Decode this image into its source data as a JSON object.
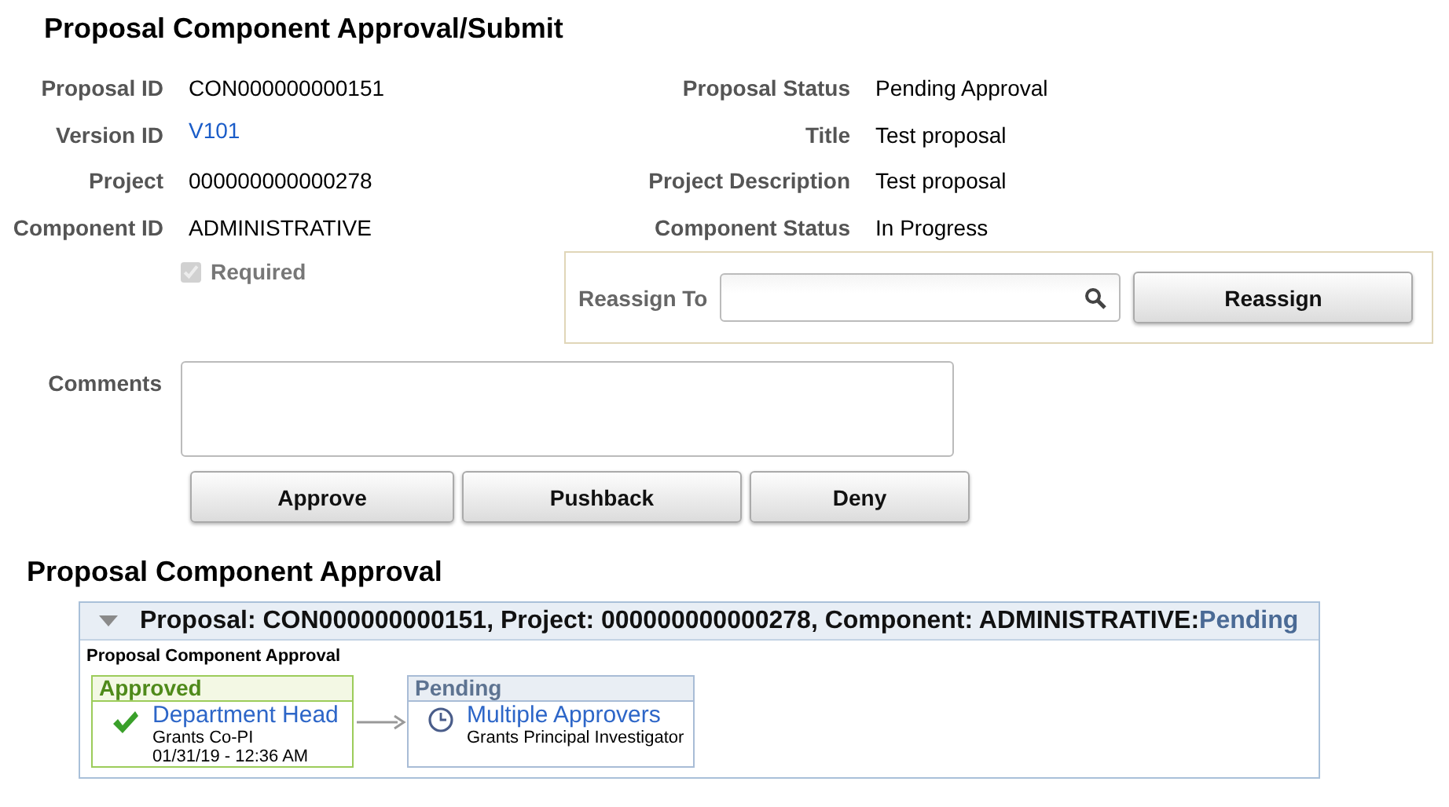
{
  "title": "Proposal Component Approval/Submit",
  "fields_left": [
    {
      "label": "Proposal ID",
      "value": "CON000000000151",
      "kind": "text"
    },
    {
      "label": "Version ID",
      "value": "V101",
      "kind": "link"
    },
    {
      "label": "Project",
      "value": "000000000000278",
      "kind": "text"
    },
    {
      "label": "Component ID",
      "value": "ADMINISTRATIVE",
      "kind": "text"
    }
  ],
  "fields_right": [
    {
      "label": "Proposal Status",
      "value": "Pending Approval"
    },
    {
      "label": "Title",
      "value": "Test proposal"
    },
    {
      "label": "Project Description",
      "value": "Test proposal"
    },
    {
      "label": "Component Status",
      "value": "In Progress"
    }
  ],
  "required": {
    "label": "Required",
    "checked": true,
    "disabled": true
  },
  "reassign": {
    "label": "Reassign To",
    "button": "Reassign"
  },
  "comments": {
    "label": "Comments"
  },
  "actions": [
    "Approve",
    "Pushback",
    "Deny"
  ],
  "approval": {
    "title": "Proposal Component Approval",
    "header": "Proposal: CON000000000151, Project: 000000000000278, Component: ADMINISTRATIVE:",
    "header_status": "Pending",
    "expanded": true,
    "subtitle": "Proposal Component Approval",
    "steps": [
      {
        "status": "Approved",
        "kind": "approved",
        "name": "Department Head",
        "lines": [
          "Grants Co-PI",
          "01/31/19 - 12:36 AM"
        ]
      },
      {
        "status": "Pending",
        "kind": "pending",
        "name": "Multiple Approvers",
        "lines": [
          "Grants Principal Investigator"
        ]
      }
    ]
  }
}
